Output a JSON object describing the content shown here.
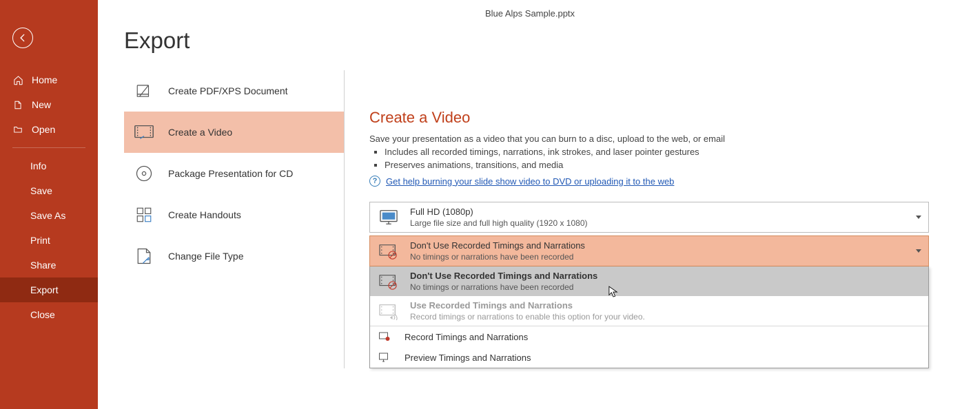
{
  "doc_title": "Blue Alps Sample.pptx",
  "page_title": "Export",
  "sidebar": {
    "items": [
      {
        "label": "Home"
      },
      {
        "label": "New"
      },
      {
        "label": "Open"
      }
    ],
    "sub": [
      {
        "label": "Info"
      },
      {
        "label": "Save"
      },
      {
        "label": "Save As"
      },
      {
        "label": "Print"
      },
      {
        "label": "Share"
      },
      {
        "label": "Export"
      },
      {
        "label": "Close"
      }
    ]
  },
  "export_options": [
    {
      "label": "Create PDF/XPS Document"
    },
    {
      "label": "Create a Video"
    },
    {
      "label": "Package Presentation for CD"
    },
    {
      "label": "Create Handouts"
    },
    {
      "label": "Change File Type"
    }
  ],
  "video": {
    "title": "Create a Video",
    "desc": "Save your presentation as a video that you can burn to a disc, upload to the web, or email",
    "b1": "Includes all recorded timings, narrations, ink strokes, and laser pointer gestures",
    "b2": "Preserves animations, transitions, and media",
    "help": "Get help burning your slide show video to DVD or uploading it to the web",
    "quality_title": "Full HD (1080p)",
    "quality_sub": "Large file size and full high quality (1920 x 1080)",
    "timings_title": "Don't Use Recorded Timings and Narrations",
    "timings_sub": "No timings or narrations have been recorded",
    "opt1_title": "Don't Use Recorded Timings and Narrations",
    "opt1_sub": "No timings or narrations have been recorded",
    "opt2_title": "Use Recorded Timings and Narrations",
    "opt2_sub": "Record timings or narrations to enable this option for your video.",
    "record": "Record Timings and Narrations",
    "preview": "Preview Timings and Narrations"
  }
}
